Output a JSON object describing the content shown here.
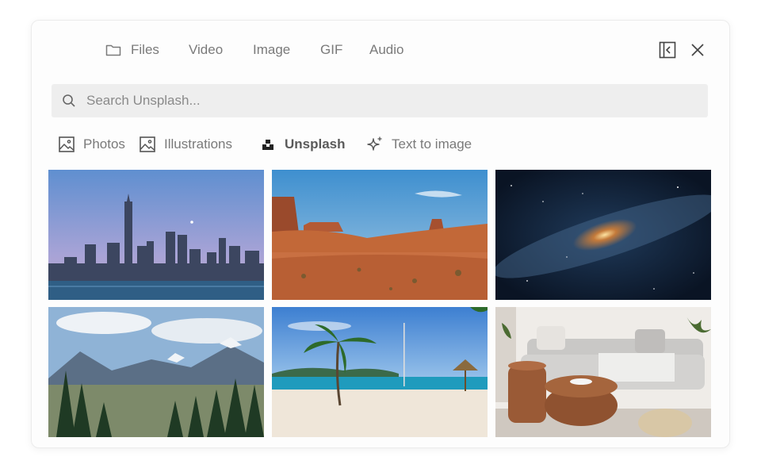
{
  "top_tabs": [
    {
      "label": "Files",
      "icon": "folder-icon"
    },
    {
      "label": "Video"
    },
    {
      "label": "Image"
    },
    {
      "label": "GIF"
    },
    {
      "label": "Audio"
    }
  ],
  "controls": {
    "collapse_icon": "collapse-panel-icon",
    "close_icon": "close-icon"
  },
  "search": {
    "placeholder": "Search Unsplash...",
    "value": "",
    "icon": "search-icon"
  },
  "source_tabs": [
    {
      "label": "Photos",
      "icon": "image-icon"
    },
    {
      "label": "Illustrations",
      "icon": "image-icon"
    },
    {
      "label": "Unsplash",
      "icon": "unsplash-logo-icon",
      "active": true
    },
    {
      "label": "Text to image",
      "icon": "sparkle-icon"
    }
  ],
  "photos": [
    {
      "name": "city-skyline-photo",
      "subject": "city skyline at dusk"
    },
    {
      "name": "desert-canyon-photo",
      "subject": "desert buttes"
    },
    {
      "name": "milky-way-photo",
      "subject": "milky way galaxy"
    },
    {
      "name": "mountain-forest-photo",
      "subject": "mountains and pine forest"
    },
    {
      "name": "tropical-beach-photo",
      "subject": "palm trees on a beach"
    },
    {
      "name": "living-room-photo",
      "subject": "living room with sofa"
    }
  ],
  "colors": {
    "accent": "#5a5a5a",
    "muted": "#7a7a7a",
    "search_bg": "#eeeeee"
  }
}
